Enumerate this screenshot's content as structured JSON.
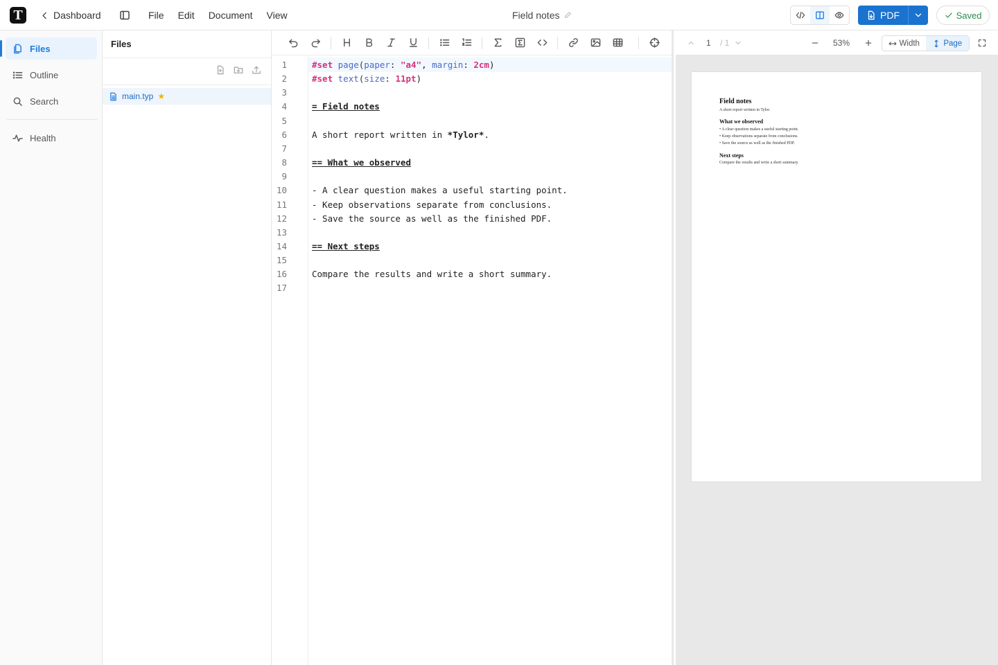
{
  "app": {
    "logo_letter": "T",
    "back_label": "Dashboard",
    "menu": [
      "File",
      "Edit",
      "Document",
      "View"
    ],
    "doc_title": "Field notes",
    "pdf_label": "PDF",
    "saved_label": "Saved",
    "accent_color": "#1a73cf"
  },
  "sidebar": {
    "items": [
      {
        "label": "Files",
        "icon": "files-icon",
        "active": true
      },
      {
        "label": "Outline",
        "icon": "list-icon",
        "active": false
      },
      {
        "label": "Search",
        "icon": "search-icon",
        "active": false
      },
      {
        "label": "Health",
        "icon": "activity-icon",
        "active": false
      }
    ]
  },
  "files_panel": {
    "title": "Files",
    "files": [
      {
        "name": "main.typ",
        "starred": true,
        "selected": true
      }
    ]
  },
  "editor": {
    "current_line": 1,
    "lines": [
      "#set page(paper: \"a4\", margin: 2cm)",
      "#set text(size: 11pt)",
      "",
      "= Field notes",
      "",
      "A short report written in *Tylor*.",
      "",
      "== What we observed",
      "",
      "- A clear question makes a useful starting point.",
      "- Keep observations separate from conclusions.",
      "- Save the source as well as the finished PDF.",
      "",
      "== Next steps",
      "",
      "Compare the results and write a short summary.",
      ""
    ]
  },
  "preview": {
    "page_current": "1",
    "page_total": "/ 1",
    "zoom": "53%",
    "fit_width_label": "Width",
    "fit_page_label": "Page",
    "fit_mode": "page",
    "document": {
      "title": "Field notes",
      "subtitle": "A short report written in Tylor.",
      "section1": "What we observed",
      "bullets": [
        "A clear question makes a useful starting point.",
        "Keep observations separate from conclusions.",
        "Save the source as well as the finished PDF."
      ],
      "section2": "Next steps",
      "closing": "Compare the results and write a short summary."
    }
  }
}
